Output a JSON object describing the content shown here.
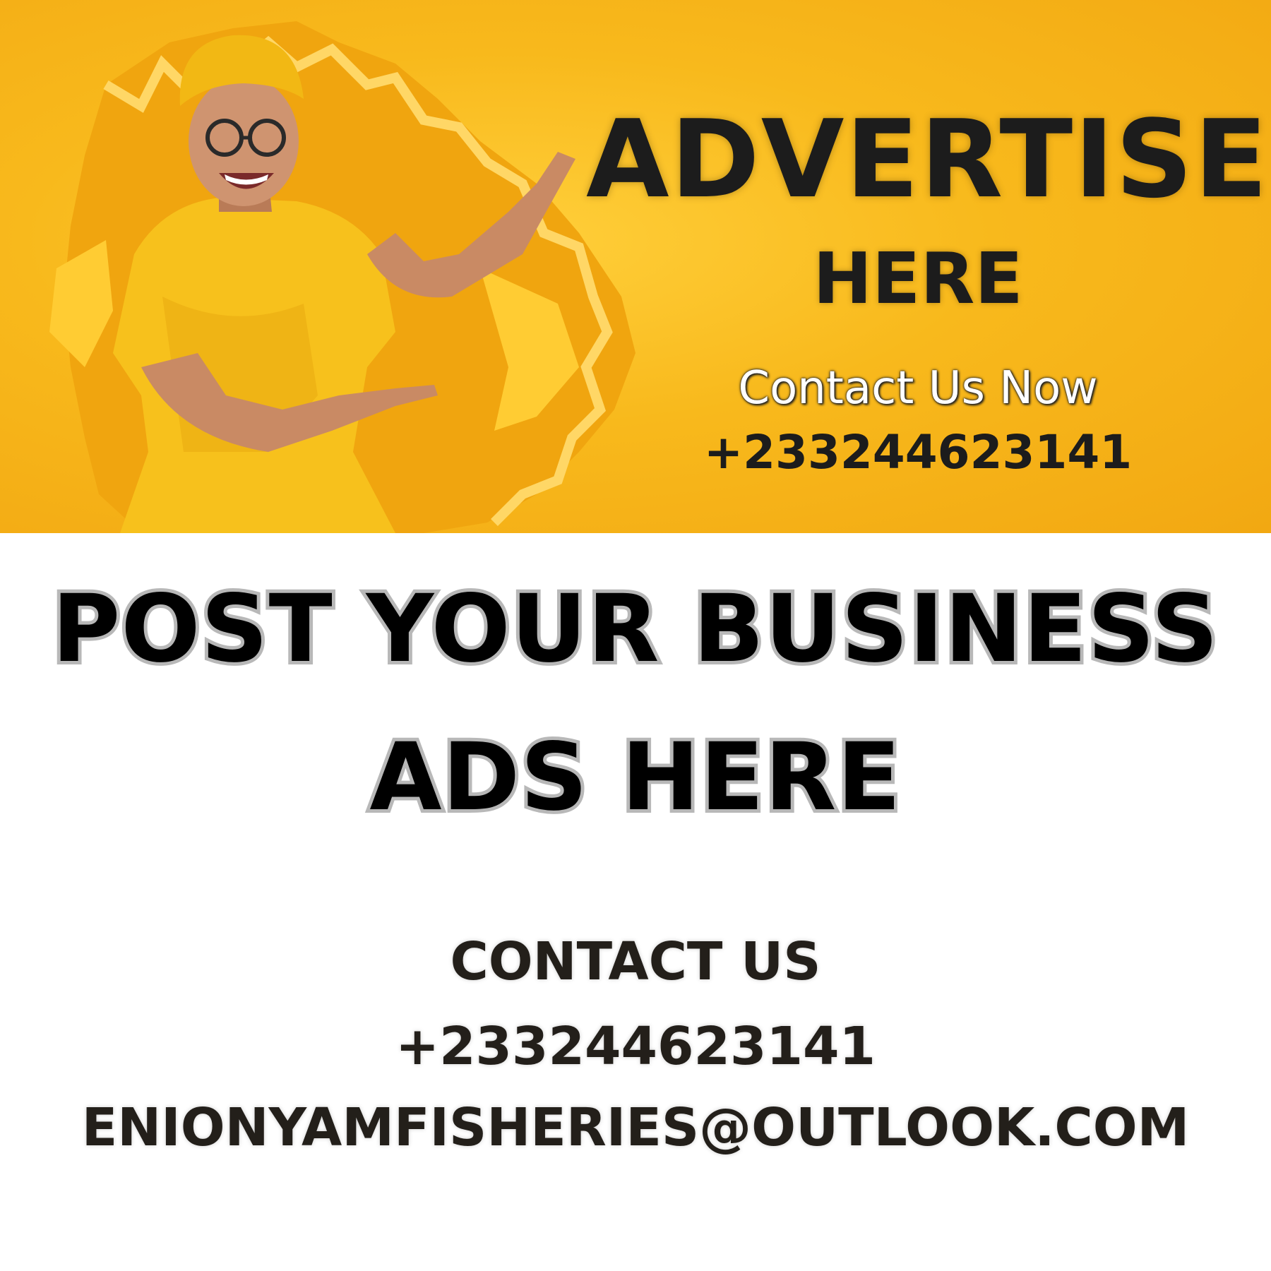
{
  "banner": {
    "advertise": "ADVERTISE",
    "here": "HERE",
    "contact_now": "Contact Us Now",
    "phone": "+233244623141"
  },
  "headline": {
    "line1": "POST YOUR BUSINESS",
    "line2": "ADS HERE"
  },
  "contact": {
    "heading": "CONTACT US",
    "phone": "+233244623141",
    "email": "ENIONYAMFISHERIES@OUTLOOK.COM"
  },
  "colors": {
    "banner_yellow": "#f8b91c",
    "text_dark": "#1c1c1c",
    "outline_gray": "#b8b8b8"
  }
}
